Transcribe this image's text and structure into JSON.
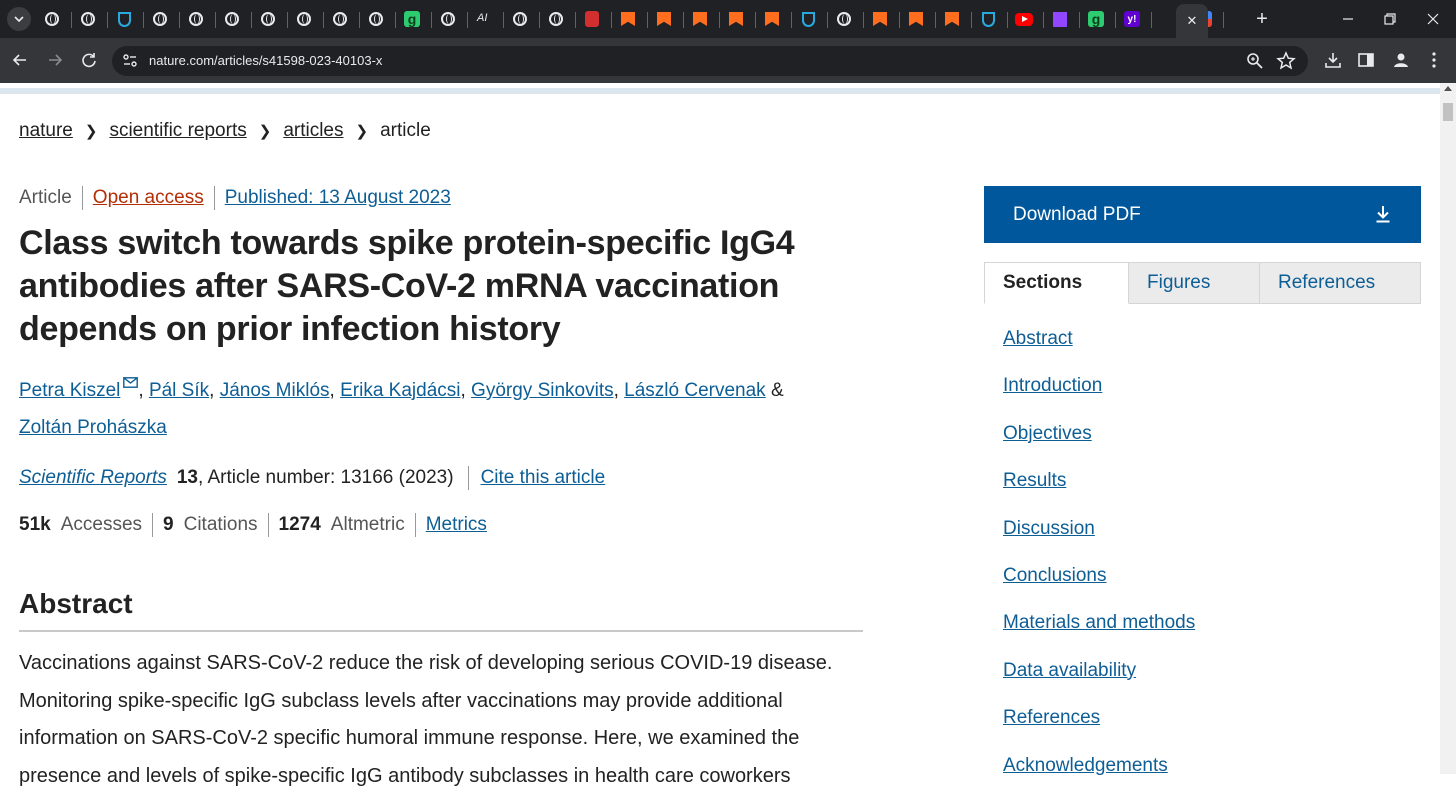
{
  "browser": {
    "url": "nature.com/articles/s41598-023-40103-x",
    "new_tab_symbol": "+",
    "close_tab_symbol": "✕",
    "tab_favicons": [
      "globe",
      "globe",
      "shield",
      "globe",
      "globe",
      "globe",
      "globe",
      "globe",
      "globe",
      "globe",
      "g-app",
      "globe",
      "ai-text",
      "globe",
      "globe",
      "red-app",
      "bookmark",
      "bookmark",
      "bookmark",
      "bookmark",
      "bookmark",
      "shield",
      "globe",
      "bookmark",
      "bookmark",
      "bookmark",
      "shield",
      "youtube",
      "twitch",
      "g-app",
      "yahoo",
      "active",
      "multicolor"
    ]
  },
  "breadcrumb": {
    "items": [
      "nature",
      "scientific reports",
      "articles",
      "article"
    ]
  },
  "article": {
    "type": "Article",
    "access": "Open access",
    "published": "Published: 13 August 2023",
    "title": "Class switch towards spike protein-specific IgG4 antibodies after SARS-CoV-2 mRNA vaccination depends on prior infection history",
    "authors": [
      "Petra Kiszel",
      "Pál Sík",
      "János Miklós",
      "Erika Kajdácsi",
      "György Sinkovits",
      "László Cervenak",
      "Zoltán Prohászka"
    ],
    "author_separators": [
      ", ",
      ", ",
      ", ",
      ", ",
      ", ",
      " & "
    ],
    "journal": "Scientific Reports",
    "volume": "13",
    "article_number": ", Article number: 13166 (2023)",
    "cite": "Cite this article",
    "metrics": {
      "accesses_value": "51k",
      "accesses_label": "Accesses",
      "citations_value": "9",
      "citations_label": "Citations",
      "altmetric_value": "1274",
      "altmetric_label": "Altmetric",
      "link": "Metrics"
    }
  },
  "abstract": {
    "heading": "Abstract",
    "text": "Vaccinations against SARS-CoV-2 reduce the risk of developing serious COVID-19 disease. Monitoring spike-specific IgG subclass levels after vaccinations may provide additional information on SARS-CoV-2 specific humoral immune response. Here, we examined the presence and levels of spike-specific IgG antibody subclasses in health care coworkers"
  },
  "sidebar": {
    "download_label": "Download PDF",
    "tabs": [
      "Sections",
      "Figures",
      "References"
    ],
    "sections": [
      "Abstract",
      "Introduction",
      "Objectives",
      "Results",
      "Discussion",
      "Conclusions",
      "Materials and methods",
      "Data availability",
      "References",
      "Acknowledgements"
    ]
  },
  "colors": {
    "link": "#0e5e96",
    "open_access": "#b32d05",
    "download_button": "#01579b",
    "chrome_dark": "#202124"
  }
}
